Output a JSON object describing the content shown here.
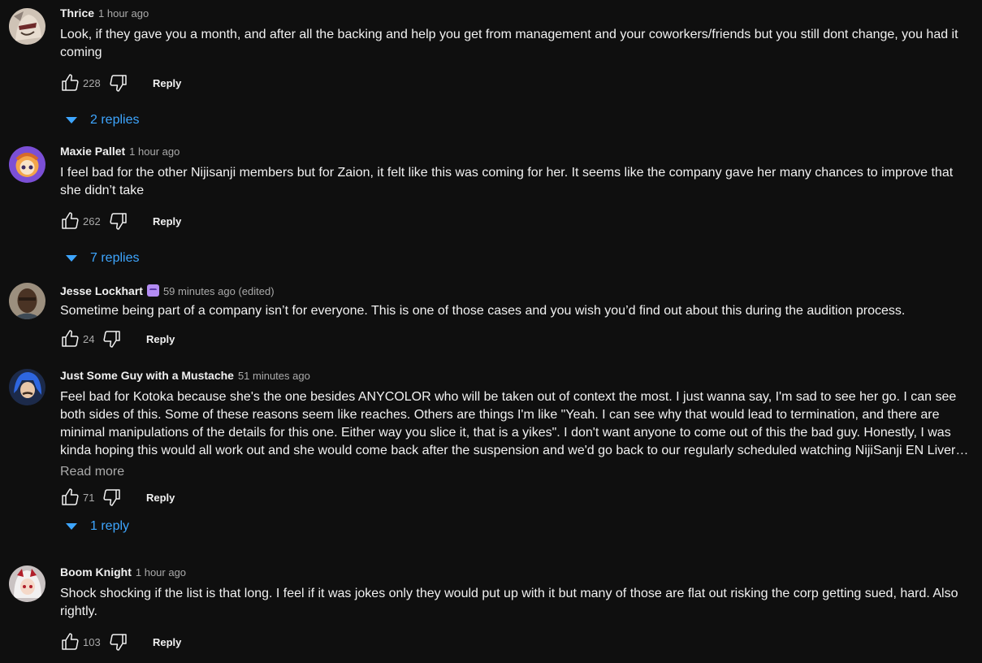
{
  "comments": [
    {
      "author": "Thrice",
      "time": "1 hour ago",
      "text": "Look, if they gave you a month, and after all the backing and help you get from management and your coworkers/friends but you still dont change, you had it coming",
      "likes": "228",
      "reply_label": "Reply",
      "replies_label": "2 replies",
      "avatar_icon": "avatar-anime-warrior"
    },
    {
      "author": "Maxie Pallet",
      "time": "1 hour ago",
      "text": "I feel bad for the other Nijisanji members but for Zaion, it felt like this was coming for her. It seems like the company gave her many chances to improve that she didn’t take",
      "likes": "262",
      "reply_label": "Reply",
      "replies_label": "7 replies",
      "avatar_icon": "avatar-purple-character"
    },
    {
      "author": "Jesse Lockhart",
      "time": "59 minutes ago (edited)",
      "text": "Sometime being part of a company isn’t for everyone.  This is one of those cases and you wish you’d find out about this during the audition process.",
      "likes": "24",
      "reply_label": "Reply",
      "avatar_icon": "avatar-photo-person",
      "badge_icon": "member-badge-icon"
    },
    {
      "author": "Just Some Guy with a Mustache",
      "time": "51 minutes ago",
      "text": "Feel bad for Kotoka because she's the one besides ANYCOLOR who will be taken out of context the most. I just wanna say, I'm sad to see her go. I can see both sides of this. Some of these reasons seem like reaches. Others are things I'm like \"Yeah. I can see why that would lead to termination, and there are minimal manipulations of the details for this one. Either way you slice it, that is a yikes\". I don't want anyone to come out of this the bad guy. Honestly, I was kinda hoping this would all work out and she would come back after the suspension and we'd go back to our regularly scheduled watching NijiSanji EN Livers vibing with eac…",
      "read_more": "Read more",
      "likes": "71",
      "reply_label": "Reply",
      "replies_label": "1 reply",
      "avatar_icon": "avatar-blue-hair-character"
    },
    {
      "author": "Boom Knight",
      "time": "1 hour ago",
      "text": "Shock shocking if the list is that long. I feel if it was jokes only they would put up with it but many of those are flat out risking the corp getting sued, hard. Also rightly.",
      "likes": "103",
      "reply_label": "Reply",
      "avatar_icon": "avatar-white-hair-character"
    }
  ],
  "colors": {
    "background": "#0f0f0f",
    "text": "#f1f1f1",
    "secondary": "#aaaaaa",
    "link": "#3ea6ff"
  }
}
